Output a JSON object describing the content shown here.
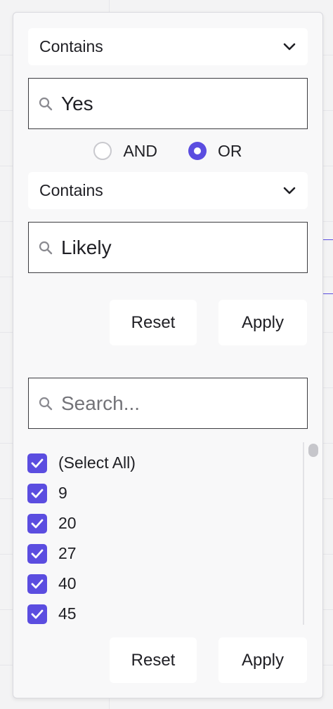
{
  "filter": {
    "condition1": {
      "operator": "Contains",
      "value": "Yes"
    },
    "join": {
      "and_label": "AND",
      "or_label": "OR",
      "selected": "OR"
    },
    "condition2": {
      "operator": "Contains",
      "value": "Likely"
    },
    "buttons": {
      "reset": "Reset",
      "apply": "Apply"
    }
  },
  "set_filter": {
    "search_placeholder": "Search...",
    "items": [
      {
        "label": "(Select All)",
        "checked": true
      },
      {
        "label": "9",
        "checked": true
      },
      {
        "label": "20",
        "checked": true
      },
      {
        "label": "27",
        "checked": true
      },
      {
        "label": "40",
        "checked": true
      },
      {
        "label": "45",
        "checked": true
      }
    ],
    "buttons": {
      "reset": "Reset",
      "apply": "Apply"
    }
  },
  "colors": {
    "accent": "#5b4de0"
  },
  "icons": {
    "dropdown": "chevron-down-icon",
    "search": "search-icon",
    "check": "check-icon"
  }
}
